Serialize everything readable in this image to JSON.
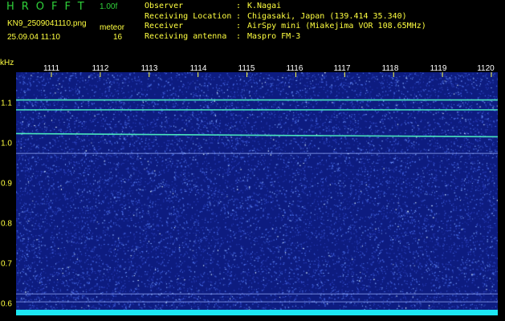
{
  "header": {
    "app_title": "HROFFT",
    "version": "1.00f",
    "filename": "KN9_2509041110.png",
    "timestamp": "25.09.04 11:10",
    "meteor_label": "meteor",
    "meteor_count": "16",
    "info": [
      {
        "key": "Observer",
        "sep": ":",
        "value": "K.Nagai"
      },
      {
        "key": "Receiving Location",
        "sep": ":",
        "value": "Chigasaki, Japan (139.414 35.340)"
      },
      {
        "key": "Receiver",
        "sep": ":",
        "value": "AirSpy mini (Miakejima VOR 108.65MHz)"
      },
      {
        "key": "Receiving antenna",
        "sep": ":",
        "value": "Maspro FM-3"
      }
    ]
  },
  "axes": {
    "y_unit": "kHz",
    "y_ticks": [
      "1.1",
      "1.0",
      "0.9",
      "0.8",
      "0.7",
      "0.6"
    ],
    "x_ticks": [
      "1111",
      "1112",
      "1113",
      "1114",
      "1115",
      "1116",
      "1117",
      "1118",
      "1119",
      "1120"
    ]
  },
  "chart_data": {
    "type": "heatmap",
    "title": "",
    "xlabel": "",
    "ylabel": "kHz",
    "x_ticks": [
      "1111",
      "1112",
      "1113",
      "1114",
      "1115",
      "1116",
      "1117",
      "1118",
      "1119",
      "1120"
    ],
    "ylim": [
      0.58,
      1.18
    ],
    "signal_lines_khz": [
      1.11,
      1.085,
      1.025,
      0.975,
      0.62,
      0.6
    ],
    "colors": {
      "background": "#0d1c80",
      "noise": "#4a6ee8",
      "signal": "#4df0c0",
      "baseline": "#1ce7f3",
      "label_yellow": "#ffff40",
      "label_green": "#2fd23a"
    }
  }
}
